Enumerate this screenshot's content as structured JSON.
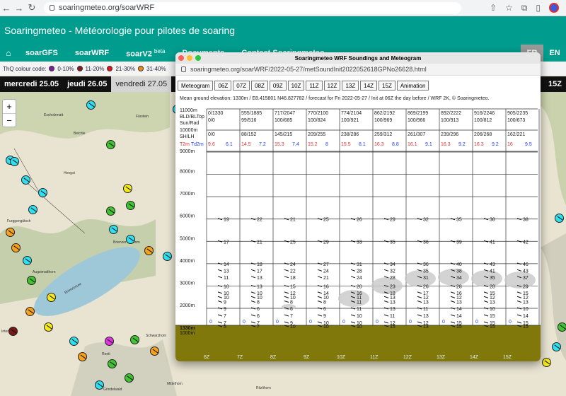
{
  "browser": {
    "url": "soaringmeteo.org/soarWRF",
    "nav": [
      "←",
      "→",
      "↻"
    ]
  },
  "site": {
    "title": "Soaringmeteo - Météorologie pour pilotes de soaring",
    "nav": [
      {
        "label": "soarGFS"
      },
      {
        "label": "soarWRF"
      },
      {
        "label": "soarV2",
        "badge": "beta"
      },
      {
        "label": "Documents"
      },
      {
        "label": "Contact Soaringmeteo"
      }
    ],
    "langs": [
      "FR",
      "EN"
    ]
  },
  "thq": {
    "label": "ThQ colour code:",
    "levels": [
      {
        "label": "0-10%",
        "color": "#7a1fa2"
      },
      {
        "label": "11-20%",
        "color": "#8b1a1a"
      },
      {
        "label": "21-30%",
        "color": "#e8141a"
      },
      {
        "label": "31-40%",
        "color": "#f58a14"
      }
    ]
  },
  "days": {
    "items": [
      "mercredi 25.05",
      "jeudi 26.05",
      "vendredi 27.05"
    ],
    "active_index": 2,
    "hour": "15Z"
  },
  "map": {
    "zoom_in": "+",
    "zoom_out": "−",
    "labels": [
      "Escholzmatt",
      "Beichle",
      "Fürstein",
      "Hengst",
      "Furggengütsch",
      "Augstmatthorn",
      "Brienzersee",
      "Brienzer Rothorn",
      "Schwarzhorn",
      "Reeti",
      "Grindelwald",
      "Mittelhorn",
      "Ritzlihorn",
      "Interlaken"
    ],
    "marker_colors": {
      "cyan": "#2fe0f0",
      "green": "#40c430",
      "yellow": "#f4ea1a",
      "orange": "#f7a21a",
      "red": "#c2231f",
      "magenta": "#e033e0",
      "darkred": "#7a1818"
    }
  },
  "popup": {
    "window_title": "Soaringmeteo WRF Soundings and Meteogram",
    "url": "soaringmeteo.org/soarWRF/2022-05-27/metSoundInit2022052618GPNo26628.html",
    "buttons": [
      "Meteogram",
      "06Z",
      "07Z",
      "08Z",
      "09Z",
      "10Z",
      "11Z",
      "12Z",
      "13Z",
      "14Z",
      "15Z",
      "Animation"
    ],
    "elevation_line": "Mean ground elevation: 1330m / E8.415801 N46.827782 / forecast for Fri 2022-05-27 / Init at 06Z the day before / WRF 2K, © Soaringmeteo.",
    "row_labels": {
      "r1": "11000m",
      "r2": "BLD/BLTop",
      "r3": "Sun/Rad",
      "r4": "10000m",
      "r5": "SH/LH",
      "r6a": "T2m",
      "r6b": "Td2m",
      "r7": "9000m"
    }
  },
  "chart_data": {
    "type": "meteogram",
    "x": [
      "6Z",
      "7Z",
      "8Z",
      "9Z",
      "10Z",
      "11Z",
      "12Z",
      "13Z",
      "14Z",
      "15Z"
    ],
    "ground_label": "1330m",
    "ground_sublabel": "1000m",
    "altitude_ticks": [
      "8000m",
      "7000m",
      "6000m",
      "5000m",
      "4000m",
      "3000m",
      "2000m"
    ],
    "bld_bltop": [
      "0/1330",
      "555/1885",
      "717/2047",
      "770/2100",
      "774/2104",
      "862/2192",
      "869/2199",
      "892/2222",
      "916/2246",
      "905/2235"
    ],
    "sun_rad": [
      "0/0",
      "99/516",
      "100/685",
      "100/824",
      "100/921",
      "100/969",
      "100/966",
      "100/913",
      "100/812",
      "100/673"
    ],
    "sh_lh": [
      "0/0",
      "88/152",
      "145/215",
      "209/255",
      "238/286",
      "259/312",
      "261/307",
      "239/296",
      "206/268",
      "162/221"
    ],
    "t2m": [
      9.6,
      14.5,
      15.3,
      15.2,
      15.5,
      16.3,
      16.1,
      16.3,
      16.3,
      16
    ],
    "td2m": [
      6.1,
      7.2,
      7.4,
      8,
      8.1,
      8.8,
      9.1,
      9.2,
      9.2,
      9.5
    ],
    "wind_6000": [
      19,
      22,
      21,
      25,
      26,
      29,
      32,
      35,
      38,
      38
    ],
    "wind_5000": [
      17,
      21,
      25,
      29,
      33,
      35,
      36,
      39,
      41,
      42
    ],
    "wind_4000": [
      14,
      18,
      24,
      27,
      31,
      34,
      36,
      40,
      43,
      46
    ],
    "wind_3700": [
      13,
      17,
      22,
      24,
      28,
      32,
      35,
      38,
      41,
      43
    ],
    "wind_3400": [
      11,
      13,
      18,
      21,
      24,
      28,
      31,
      34,
      35,
      37
    ],
    "wind_3000": [
      10,
      13,
      15,
      16,
      20,
      23,
      26,
      28,
      28,
      29
    ],
    "wind_2700": [
      10,
      10,
      12,
      14,
      16,
      18,
      17,
      16,
      15,
      15
    ],
    "wind_2500": [
      10,
      10,
      10,
      10,
      11,
      13,
      12,
      12,
      12,
      12
    ],
    "wind_2300": [
      9,
      8,
      8,
      8,
      11,
      13,
      13,
      13,
      13,
      13
    ],
    "wind_2000": [
      9,
      6,
      6,
      6,
      11,
      13,
      11,
      14,
      10,
      10
    ],
    "wind_1800": [
      7,
      6,
      7,
      9,
      10,
      11,
      13,
      14,
      15,
      14
    ],
    "wind_1600": [
      7,
      7,
      9,
      10,
      10,
      12,
      12,
      15,
      15,
      15
    ],
    "wind_1500": [
      5,
      7,
      10,
      10,
      10,
      15,
      13,
      15,
      15,
      15
    ]
  }
}
